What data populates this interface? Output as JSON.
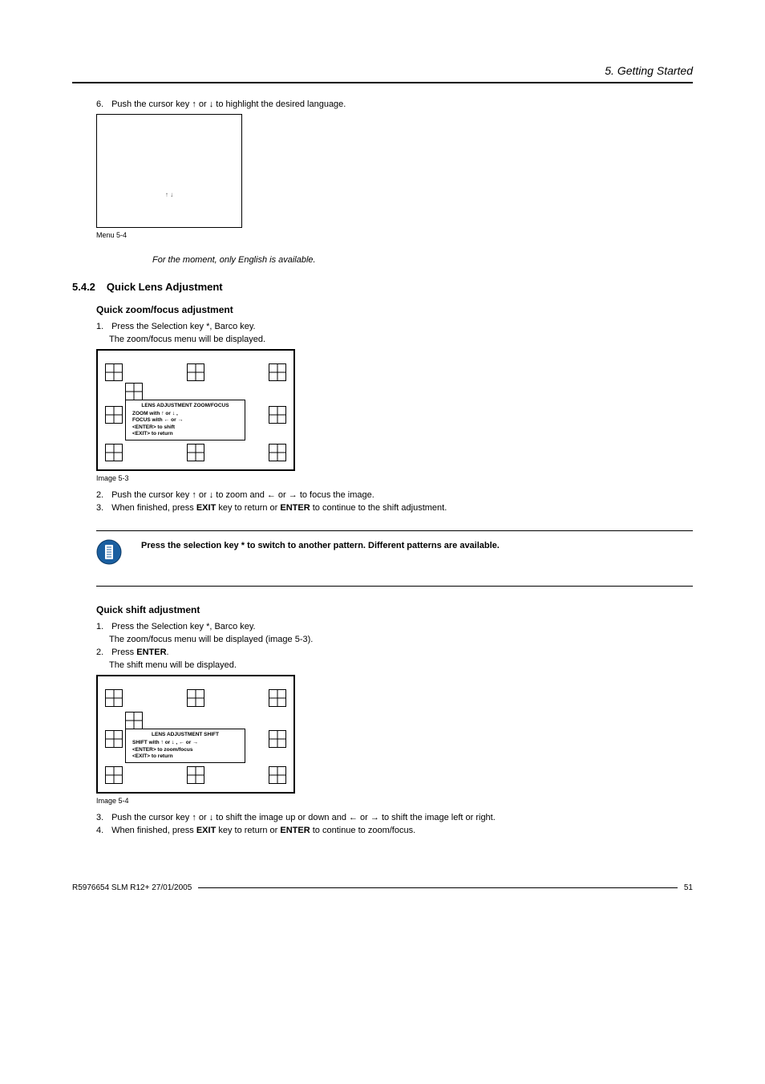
{
  "header": {
    "chapter": "5.  Getting Started"
  },
  "step6": {
    "num": "6.",
    "text": "Push the cursor key ↑ or ↓ to highlight the desired language.",
    "arrows": "↑        ↓",
    "caption": "Menu 5-4"
  },
  "italic_note": "For the moment, only English is available.",
  "section": {
    "number": "5.4.2",
    "title": "Quick Lens Adjustment"
  },
  "zoomfocus": {
    "title": "Quick zoom/focus adjustment",
    "s1_num": "1.",
    "s1_text": "Press the Selection key *, Barco key.",
    "s1_sub": "The zoom/focus menu will be displayed.",
    "box": {
      "title": "LENS ADJUSTMENT ZOOM/FOCUS",
      "l1a": "ZOOM with ",
      "l1b": " or ",
      "l1c": " ,",
      "l2a": "FOCUS with ",
      "l2b": " or ",
      "l3": "<ENTER> to shift",
      "l4": "<EXIT> to return"
    },
    "img_caption": "Image 5-3",
    "s2_num": "2.",
    "s2_text": "Push the cursor key ↑ or ↓ to zoom and ← or → to focus the image.",
    "s3_num": "3.",
    "s3_a": "When finished, press ",
    "s3_exit": "EXIT",
    "s3_b": " key to return or ",
    "s3_enter": "ENTER",
    "s3_c": " to continue to the shift adjustment."
  },
  "note": {
    "text": "Press the selection key * to switch to another pattern.  Different patterns are available."
  },
  "shift": {
    "title": "Quick shift adjustment",
    "s1_num": "1.",
    "s1_text": "Press the Selection key *, Barco key.",
    "s1_sub": "The zoom/focus menu will be displayed (image 5-3).",
    "s2_num": "2.",
    "s2_a": "Press ",
    "s2_enter": "ENTER",
    "s2_b": ".",
    "s2_sub": "The shift menu will be displayed.",
    "box": {
      "title": "LENS ADJUSTMENT SHIFT",
      "l1a": "SHIFT with ",
      "l1b": " or ",
      "l1c": " , ",
      "l1d": " or ",
      "l2": "<ENTER> to zoom/focus",
      "l3": "<EXIT> to return"
    },
    "img_caption": "Image 5-4",
    "s3_num": "3.",
    "s3_text": "Push the cursor key ↑ or ↓ to shift the image up or down and ← or → to shift the image left or right.",
    "s4_num": "4.",
    "s4_a": "When finished, press ",
    "s4_exit": "EXIT",
    "s4_b": " key to return or ",
    "s4_enter": "ENTER",
    "s4_c": " to continue to zoom/focus."
  },
  "footer": {
    "left": "R5976654  SLM R12+  27/01/2005",
    "right": "51"
  }
}
